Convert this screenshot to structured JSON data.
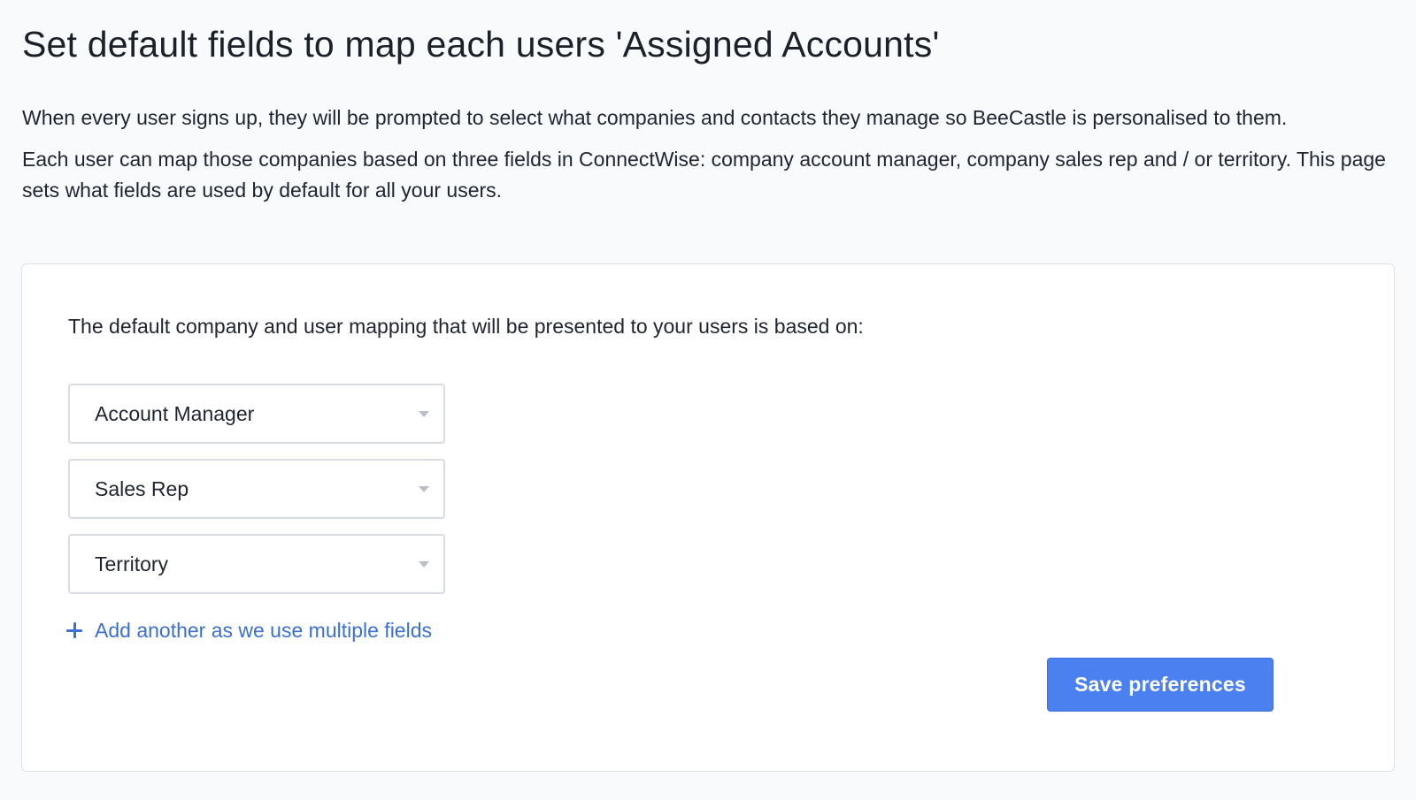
{
  "page": {
    "title": "Set default fields to map each users 'Assigned Accounts'",
    "intro_1": "When every user signs up, they will be prompted to select what companies and contacts they manage so BeeCastle is personalised to them.",
    "intro_2": "Each user can map those companies based on three fields in ConnectWise: company account manager, company sales rep and / or territory. This page sets what fields are used by default for all your users."
  },
  "card": {
    "prompt": "The default company and user mapping that will be presented to your users is based on:",
    "selects": [
      {
        "value": "Account Manager"
      },
      {
        "value": "Sales Rep"
      },
      {
        "value": "Territory"
      }
    ],
    "add_link_label": "Add another as we use multiple fields",
    "save_label": "Save preferences"
  },
  "colors": {
    "accent": "#4a80f0",
    "link": "#3a6fd8",
    "background": "#f8fafc"
  },
  "icons": {
    "add": "plus-icon",
    "dropdown": "chevron-down-icon"
  }
}
